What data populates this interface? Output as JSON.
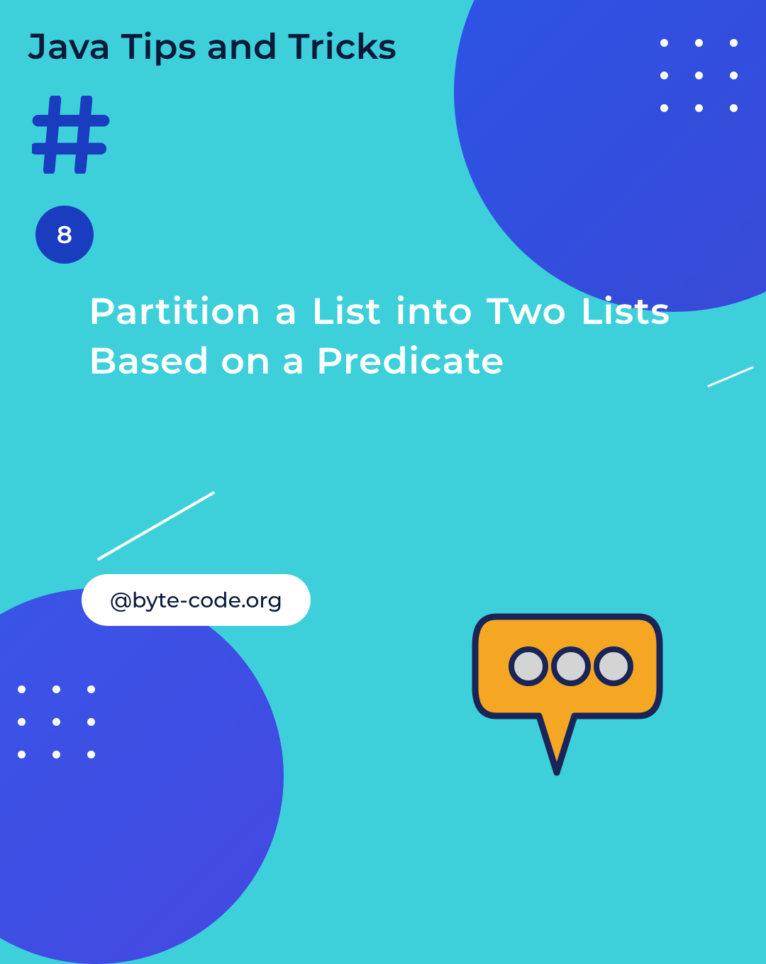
{
  "title": "Java Tips and Tricks",
  "tipNumber": "8",
  "description": "Partition a List into Two Lists Based on a Predicate",
  "handle": "@byte-code.org",
  "colors": {
    "background": "#3dd0db",
    "circleGradient1": "#2b55e8",
    "circleGradient2": "#3a48d4",
    "badge": "#1a3dbf",
    "speechBubble": "#f5a623",
    "speechBubbleStroke": "#1a2456"
  }
}
